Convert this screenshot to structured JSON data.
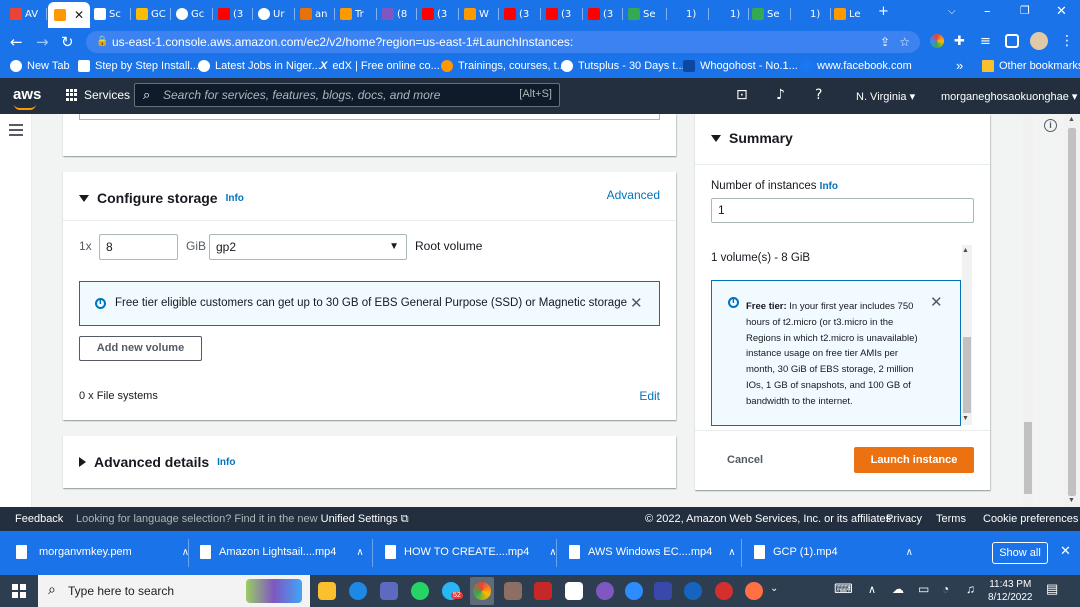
{
  "browser": {
    "tabs": [
      {
        "label": "AV",
        "color": "#ea4335"
      },
      {
        "label": "",
        "color": "#ff9900",
        "active": true
      },
      {
        "label": "Sc",
        "color": "#ffffff"
      },
      {
        "label": "GC",
        "color": "#fbbc04"
      },
      {
        "label": "Gc",
        "color": "#ffffff"
      },
      {
        "label": "(3",
        "color": "#ff0000"
      },
      {
        "label": "Ur",
        "color": "#ffffff"
      },
      {
        "label": "an",
        "color": "#e8710a"
      },
      {
        "label": "Tr",
        "color": "#ff9900"
      },
      {
        "label": "(8",
        "color": "#7e57c2"
      },
      {
        "label": "(3",
        "color": "#ff0000"
      },
      {
        "label": "W",
        "color": "#ff9900"
      },
      {
        "label": "(3",
        "color": "#ff0000"
      },
      {
        "label": "(3",
        "color": "#ff0000"
      },
      {
        "label": "(3",
        "color": "#ff0000"
      },
      {
        "label": "Se",
        "color": "#34a853"
      },
      {
        "label": "1)",
        "color": "#1a73e8"
      },
      {
        "label": "1)",
        "color": "#1a73e8"
      },
      {
        "label": "Se",
        "color": "#34a853"
      },
      {
        "label": "1)",
        "color": "#1a73e8"
      },
      {
        "label": "Le",
        "color": "#ff9900"
      }
    ],
    "new_tab": "+",
    "url": "us-east-1.console.aws.amazon.com/ec2/v2/home?region=us-east-1#LaunchInstances:",
    "bookmarks": [
      {
        "label": "New Tab",
        "color": "#ffffff"
      },
      {
        "label": "Step by Step Install...",
        "color": "#ffffff"
      },
      {
        "label": "Latest Jobs in Niger...",
        "color": "#ffffff"
      },
      {
        "label": "edX | Free online co...",
        "color": "#ffffff"
      },
      {
        "label": "Trainings, courses, t...",
        "color": "#ff9800"
      },
      {
        "label": "Tutsplus - 30 Days t...",
        "color": "#ffffff"
      },
      {
        "label": "Whogohost - No.1...",
        "color": "#0d47a1"
      },
      {
        "label": "www.facebook.com",
        "color": "#1877f2"
      }
    ],
    "bookmarks_more": "»",
    "other_bookmarks": "Other bookmarks"
  },
  "aws_nav": {
    "logo": "aws",
    "services": "Services",
    "search_placeholder": "Search for services, features, blogs, docs, and more",
    "search_shortcut": "[Alt+S]",
    "region": "N. Virginia",
    "account": "morganeghosaokuonghae"
  },
  "storage": {
    "title": "Configure storage",
    "info": "Info",
    "advanced": "Advanced",
    "multiplier": "1x",
    "size": "8",
    "unit": "GiB",
    "volume_type": "gp2",
    "volume_label": "Root volume",
    "alert": "Free tier eligible customers can get up to 30 GB of EBS General Purpose (SSD) or Magnetic storage",
    "add_volume": "Add new volume",
    "file_systems": "0 x File systems",
    "edit": "Edit"
  },
  "advanced_details": {
    "title": "Advanced details",
    "info": "Info"
  },
  "summary": {
    "title": "Summary",
    "instances_label": "Number of instances",
    "info": "Info",
    "instances_value": "1",
    "volumes": "1 volume(s) - 8 GiB",
    "free_tier_label": "Free tier:",
    "free_tier_text": "In your first year includes 750 hours of t2.micro (or t3.micro in the Regions in which t2.micro is unavailable) instance usage on free tier AMIs per month, 30 GiB of EBS storage, 2 million IOs, 1 GB of snapshots, and 100 GB of bandwidth to the internet.",
    "cancel": "Cancel",
    "launch": "Launch instance"
  },
  "footer": {
    "feedback": "Feedback",
    "lang_prompt": "Looking for language selection? Find it in the new",
    "unified_settings": "Unified Settings",
    "copyright": "© 2022, Amazon Web Services, Inc. or its affiliates.",
    "privacy": "Privacy",
    "terms": "Terms",
    "cookies": "Cookie preferences"
  },
  "downloads": {
    "items": [
      "morganvmkey.pem",
      "Amazon Lightsail....mp4",
      "HOW TO CREATE....mp4",
      "AWS Windows EC....mp4",
      "GCP (1).mp4"
    ],
    "show_all": "Show all"
  },
  "taskbar": {
    "search_placeholder": "Type here to search",
    "time": "11:43 PM",
    "date": "8/12/2022",
    "badge": "52"
  },
  "colors": {
    "chrome_blue": "#1a73e8",
    "aws_nav": "#232f3e",
    "aws_orange": "#ec7211",
    "link": "#0073bb"
  }
}
